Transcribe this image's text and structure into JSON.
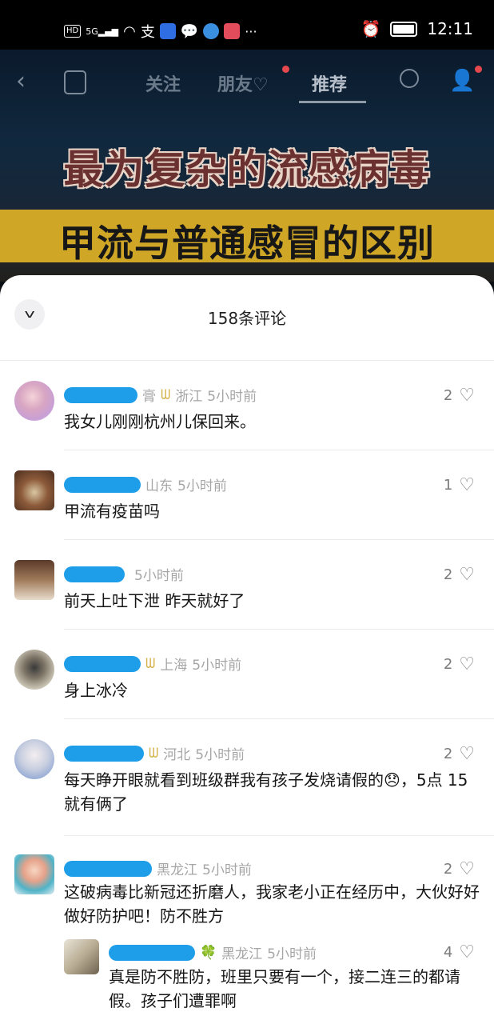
{
  "status": {
    "time": "12:11",
    "hd": "HD",
    "signal": "5G",
    "more": "···"
  },
  "nav": {
    "tabs": [
      "关注",
      "朋友♡",
      "推荐"
    ]
  },
  "video": {
    "title1": "最为复杂的流感病毒",
    "title2": "甲流与普通感冒的区别"
  },
  "sheet": {
    "title": "158条评论"
  },
  "comments": [
    {
      "name_tail": "膏",
      "badge": true,
      "location": "浙江",
      "time": "5小时前",
      "likes": "2",
      "text": "我女儿刚刚杭州儿保回来。"
    },
    {
      "name_tail": "",
      "badge": false,
      "location": "山东",
      "time": "5小时前",
      "likes": "1",
      "text": "甲流有疫苗吗"
    },
    {
      "name_tail": "",
      "badge": false,
      "location": "",
      "time": "5小时前",
      "likes": "2",
      "text": "前天上吐下泄 昨天就好了"
    },
    {
      "name_tail": "",
      "badge": true,
      "location": "上海",
      "time": "5小时前",
      "likes": "2",
      "text": "身上冰冷"
    },
    {
      "name_tail": "",
      "badge": true,
      "location": "河北",
      "time": "5小时前",
      "likes": "2",
      "text": "每天睁开眼就看到班级群我有孩子发烧请假的😞，5点 15 就有俩了"
    },
    {
      "name_tail": "",
      "badge": false,
      "location": "黑龙江",
      "time": "5小时前",
      "likes": "2",
      "text": "这破病毒比新冠还折磨人，我家老小正在经历中，大伙好好做好防护吧！防不胜方"
    }
  ],
  "reply": {
    "badge": "🍀",
    "location": "黑龙江",
    "time": "5小时前",
    "likes": "4",
    "text": "真是防不胜防，班里只要有一个，接二连三的都请假。孩子们遭罪啊"
  }
}
